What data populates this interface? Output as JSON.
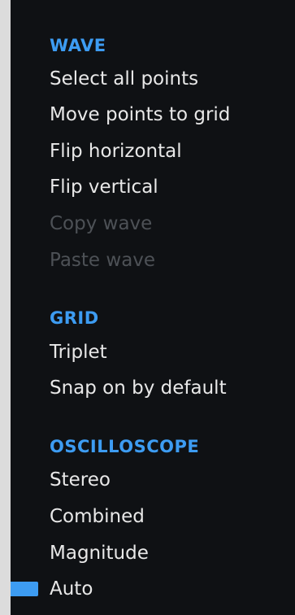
{
  "accent_color": "#3d9cf2",
  "sections": [
    {
      "title": "WAVE",
      "items": [
        {
          "label": "Select all points",
          "enabled": true,
          "checked": false
        },
        {
          "label": "Move points to grid",
          "enabled": true,
          "checked": false
        },
        {
          "label": "Flip horizontal",
          "enabled": true,
          "checked": false
        },
        {
          "label": "Flip vertical",
          "enabled": true,
          "checked": false
        },
        {
          "label": "Copy wave",
          "enabled": false,
          "checked": false
        },
        {
          "label": "Paste wave",
          "enabled": false,
          "checked": false
        }
      ]
    },
    {
      "title": "GRID",
      "items": [
        {
          "label": "Triplet",
          "enabled": true,
          "checked": false
        },
        {
          "label": "Snap on by default",
          "enabled": true,
          "checked": false
        }
      ]
    },
    {
      "title": "OSCILLOSCOPE",
      "items": [
        {
          "label": "Stereo",
          "enabled": true,
          "checked": false
        },
        {
          "label": "Combined",
          "enabled": true,
          "checked": false
        },
        {
          "label": "Magnitude",
          "enabled": true,
          "checked": false
        },
        {
          "label": "Auto",
          "enabled": true,
          "checked": true
        }
      ]
    }
  ]
}
